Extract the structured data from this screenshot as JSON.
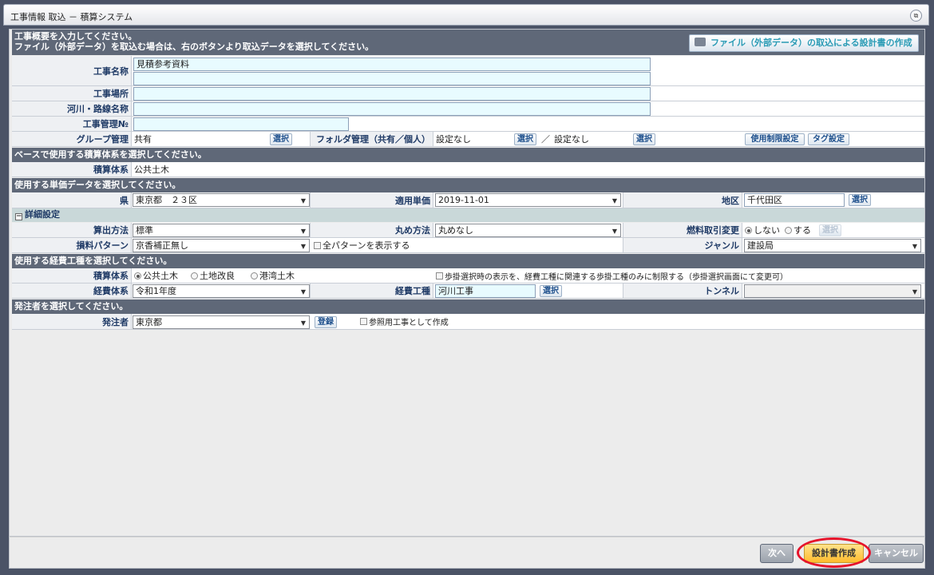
{
  "window": {
    "title": "工事情報 取込 － 積算システム"
  },
  "intro": {
    "line1": "工事概要を入力してください。",
    "line2": "ファイル（外部データ）を取込む場合は、右のボタンより取込データを選択してください。",
    "import_button": "ファイル（外部データ）の取込による設計書の作成"
  },
  "overview": {
    "name_label": "工事名称",
    "name_value": "見積参考資料",
    "place_label": "工事場所",
    "place_value": "",
    "river_label": "河川・路線名称",
    "river_value": "",
    "mgmt_no_label": "工事管理№",
    "mgmt_no_value": "",
    "group_label": "グループ管理",
    "group_value": "共有",
    "folder_label": "フォルダ管理（共有／個人）",
    "folder_value1": "設定なし",
    "folder_sep": "／",
    "folder_value2": "設定なし",
    "select_label": "選択",
    "usage_limit_button": "使用制限設定",
    "tag_button": "タグ設定"
  },
  "base": {
    "header": "ベースで使用する積算体系を選択してください。",
    "system_label": "積算体系",
    "system_value": "公共土木"
  },
  "unit_price": {
    "header": "使用する単価データを選択してください。",
    "pref_label": "県",
    "pref_value": "東京都　２３区",
    "applied_label": "適用単価",
    "applied_value": "2019-11-01",
    "area_label": "地区",
    "area_value": "千代田区",
    "select_label": "選択"
  },
  "detail": {
    "header": "詳細設定",
    "calc_label": "算出方法",
    "calc_value": "標準",
    "round_label": "丸め方法",
    "round_value": "丸めなし",
    "fuel_label": "燃料取引変更",
    "fuel_no": "しない",
    "fuel_yes": "する",
    "fuel_select": "選択",
    "loss_label": "損料パターン",
    "loss_value": "京香補正無し",
    "show_all_patterns": "全パターンを表示する",
    "genre_label": "ジャンル",
    "genre_value": "建設局"
  },
  "expense": {
    "header": "使用する経費工種を選択してください。",
    "system_label": "積算体系",
    "radio1": "公共土木",
    "radio2": "土地改良",
    "radio3": "港湾土木",
    "restrict_text": "歩掛選択時の表示を、経費工種に関連する歩掛工種のみに制限する（歩掛選択画面にて変更可）",
    "exp_system_label": "経費体系",
    "exp_system_value": "令和1年度",
    "exp_kind_label": "経費工種",
    "exp_kind_value": "河川工事",
    "select_label": "選択",
    "tunnel_label": "トンネル",
    "tunnel_value": ""
  },
  "orderer": {
    "header": "発注者を選択してください。",
    "label": "発注者",
    "value": "東京都",
    "register": "登録",
    "reference": "参照用工事として作成"
  },
  "footer": {
    "next": "次へ",
    "create": "設計書作成",
    "cancel": "キャンセル"
  },
  "colors": {
    "header_bg": "#5f6878",
    "label_text": "#1f3a66",
    "input_bg": "#e8fbff",
    "highlight_ring": "#e6132b",
    "primary_button": "#ffbb2d"
  }
}
